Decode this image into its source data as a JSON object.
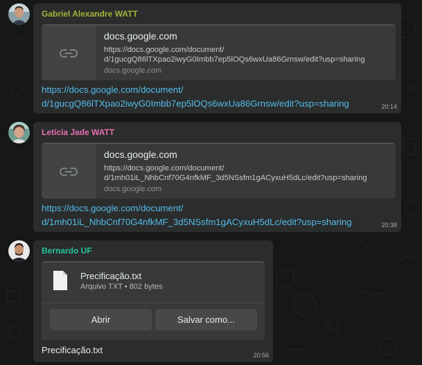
{
  "messages": [
    {
      "sender": "Gabriel Alexandre WATT",
      "sender_color": "#a7b23a",
      "preview": {
        "title": "docs.google.com",
        "description_line1": "https://docs.google.com/document/",
        "description_line2": "d/1gucgQ86lTXpao2iwyG0Imbb7ep5lOQs6wxUa86Grnsw/edit?usp=sharing",
        "domain": "docs.google.com"
      },
      "link_line1": "https://docs.google.com/document/",
      "link_line2": "d/1gucgQ86lTXpao2iwyG0Imbb7ep5lOQs6wxUa86Grnsw/edit?usp=sharing",
      "time": "20:14"
    },
    {
      "sender": "Letícia Jade WATT",
      "sender_color": "#e86fb0",
      "preview": {
        "title": "docs.google.com",
        "description_line1": "https://docs.google.com/document/",
        "description_line2": "d/1mh01iL_NhbCnf70G4nfkMF_3d5NSsfm1gACyxuH5dLc/edit?usp=sharing",
        "domain": "docs.google.com"
      },
      "link_line1": "https://docs.google.com/document/",
      "link_line2": "d/1mh01iL_NhbCnf70G4nfkMF_3d5NSsfm1gACyxuH5dLc/edit?usp=sharing",
      "time": "20:38"
    },
    {
      "sender": "Bernardo UF",
      "sender_color": "#25c49a",
      "file": {
        "name": "Precificação.txt",
        "meta": "Arquivo TXT • 802 bytes",
        "open_label": "Abrir",
        "save_label": "Salvar como..."
      },
      "caption": "Precificação.txt",
      "time": "20:56"
    }
  ],
  "icons": {
    "link_preview": "link-icon",
    "file": "document-icon"
  },
  "colors": {
    "background": "#161717",
    "bubble": "#2b2c2c",
    "preview": "#383939",
    "link": "#53bdeb"
  }
}
